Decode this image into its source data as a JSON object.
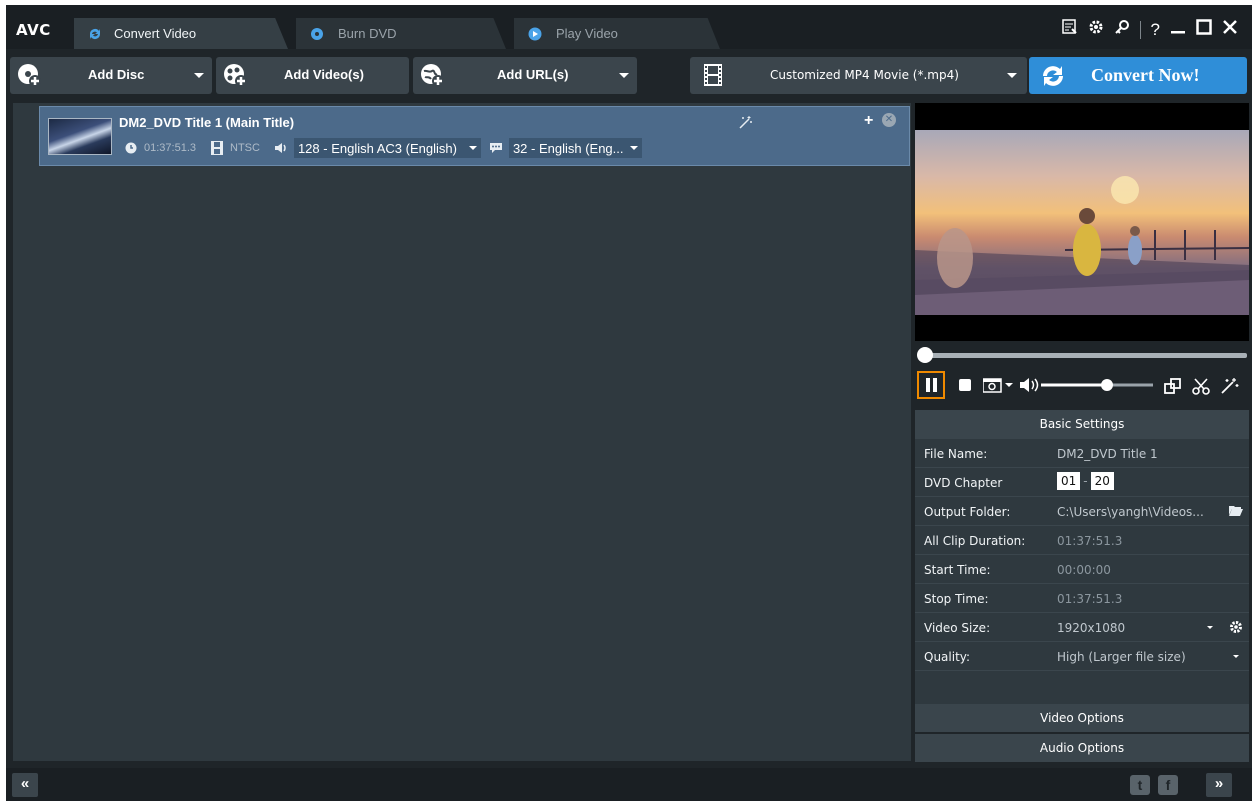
{
  "app": {
    "logo": "AVC"
  },
  "tabs": [
    {
      "label": "Convert Video",
      "active": true,
      "icon": "refresh-icon"
    },
    {
      "label": "Burn DVD",
      "active": false,
      "icon": "disc-icon"
    },
    {
      "label": "Play Video",
      "active": false,
      "icon": "play-icon"
    }
  ],
  "window_controls": {
    "help": "?",
    "icons": [
      "register-icon",
      "gear-icon",
      "key-icon",
      "help-icon",
      "minimize-icon",
      "maximize-icon",
      "close-icon"
    ]
  },
  "toolbar": {
    "add_disc": "Add Disc",
    "add_video": "Add Video(s)",
    "add_url": "Add URL(s)",
    "profile": "Customized MP4 Movie (*.mp4)",
    "convert": "Convert Now!"
  },
  "file_item": {
    "title": "DM2_DVD Title 1 (Main Title)",
    "duration": "01:37:51.3",
    "standard": "NTSC",
    "audio_track": "128 - English AC3 (English)",
    "subtitle": "32 - English (Eng..."
  },
  "player": {
    "state": "paused",
    "progress": 0,
    "volume": 0.6
  },
  "settings": {
    "header": "Basic Settings",
    "file_name_label": "File Name:",
    "file_name": "DM2_DVD Title 1",
    "dvd_chapter_label": "DVD Chapter",
    "chapter_start": "01",
    "chapter_end": "20",
    "output_folder_label": "Output Folder:",
    "output_folder": "C:\\Users\\yangh\\Videos...",
    "all_clip_duration_label": "All Clip Duration:",
    "all_clip_duration": "01:37:51.3",
    "start_time_label": "Start Time:",
    "start_time": "00:00:00",
    "stop_time_label": "Stop Time:",
    "stop_time": "01:37:51.3",
    "video_size_label": "Video Size:",
    "video_size": "1920x1080",
    "quality_label": "Quality:",
    "quality": "High (Larger file size)",
    "video_options": "Video Options",
    "audio_options": "Audio Options"
  },
  "statusbar": {
    "collapse": "«",
    "expand": "»",
    "twitter": "t",
    "facebook": "f"
  },
  "colors": {
    "accent": "#2f8ed8",
    "focus": "#f08a00",
    "selected_row": "#4c6a8a"
  }
}
